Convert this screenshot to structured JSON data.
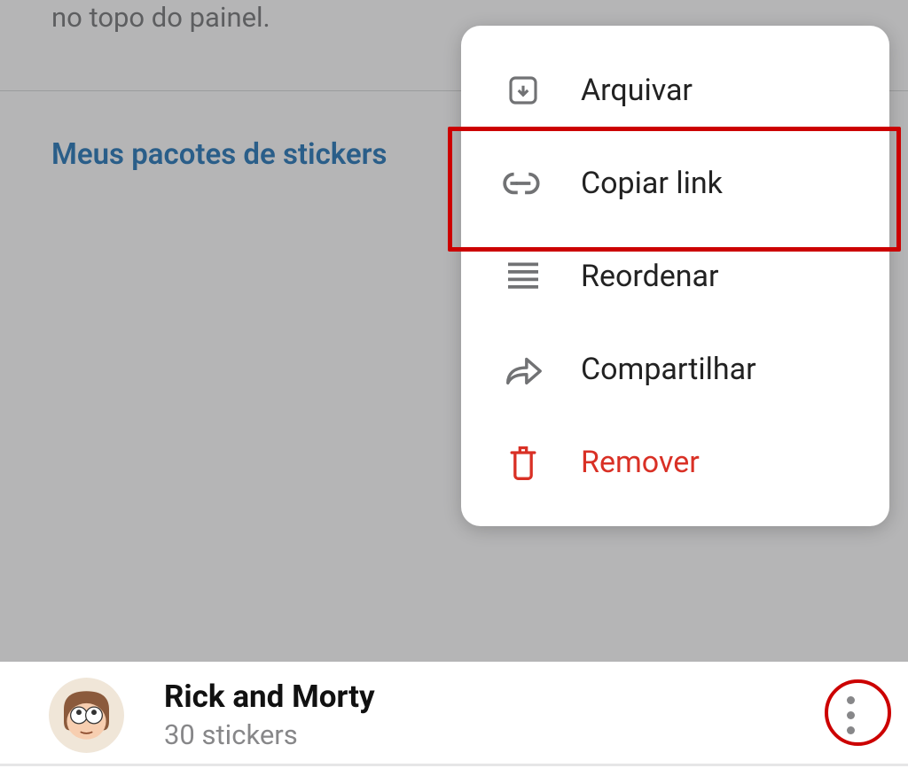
{
  "description": "no topo do painel.",
  "section_title": "Meus pacotes de stickers",
  "menu": {
    "archive": "Arquivar",
    "copy_link": "Copiar link",
    "reorder": "Reordenar",
    "share": "Compartilhar",
    "remove": "Remover"
  },
  "sticker_pack": {
    "name": "Rick and Morty",
    "count": "30 stickers"
  }
}
